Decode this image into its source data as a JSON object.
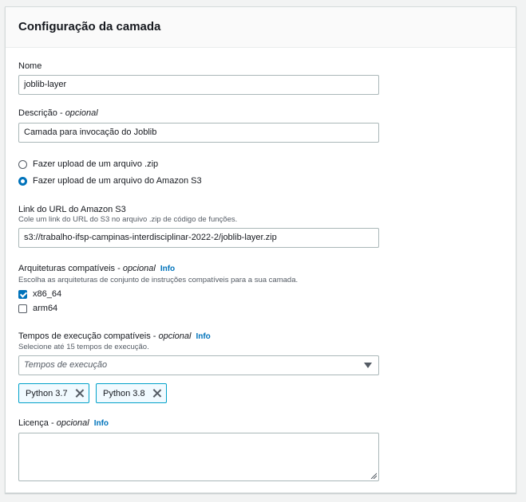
{
  "panel": {
    "title": "Configuração da camada"
  },
  "name_field": {
    "label": "Nome",
    "value": "joblib-layer"
  },
  "description_field": {
    "label": "Descrição",
    "optional": "opcional",
    "value": "Camada para invocação do Joblib"
  },
  "upload_options": [
    {
      "label": "Fazer upload de um arquivo .zip",
      "checked": false
    },
    {
      "label": "Fazer upload de um arquivo do Amazon S3",
      "checked": true
    }
  ],
  "s3_link_field": {
    "label": "Link do URL do Amazon S3",
    "description": "Cole um link do URL do S3 no arquivo .zip de código de funções.",
    "value": "s3://trabalho-ifsp-campinas-interdisciplinar-2022-2/joblib-layer.zip"
  },
  "architectures": {
    "label": "Arquiteturas compatíveis",
    "optional": "opcional",
    "info": "Info",
    "description": "Escolha as arquiteturas de conjunto de instruções compatíveis para a sua camada.",
    "options": [
      {
        "label": "x86_64",
        "checked": true
      },
      {
        "label": "arm64",
        "checked": false
      }
    ]
  },
  "runtimes": {
    "label": "Tempos de execução compatíveis",
    "optional": "opcional",
    "info": "Info",
    "description": "Selecione até 15 tempos de execução.",
    "placeholder": "Tempos de execução",
    "tokens": [
      {
        "label": "Python 3.7"
      },
      {
        "label": "Python 3.8"
      }
    ]
  },
  "license": {
    "label": "Licença",
    "optional": "opcional",
    "info": "Info",
    "value": ""
  },
  "colors": {
    "accent": "#0073bb",
    "token_border": "#00a1c9",
    "token_bg": "#f1faff"
  }
}
